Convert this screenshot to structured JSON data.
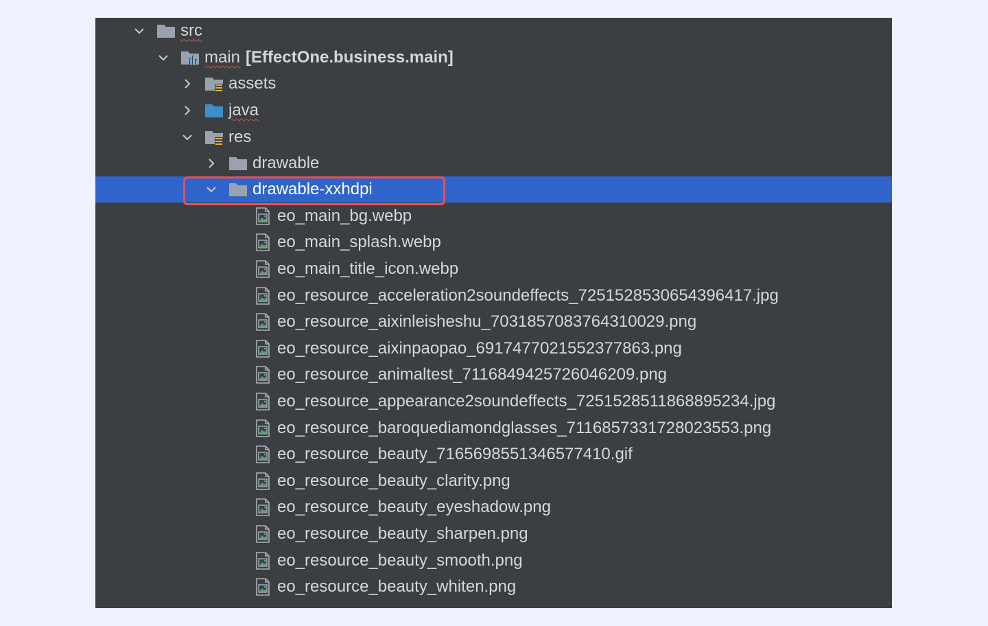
{
  "tree": {
    "src": {
      "label": "src",
      "expanded": true,
      "icon": "folder-icon"
    },
    "main": {
      "label": "main",
      "module": "[EffectOne.business.main]",
      "expanded": true,
      "icon": "module-folder-icon"
    },
    "assets": {
      "label": "assets",
      "expanded": false,
      "icon": "resource-folder-icon"
    },
    "java": {
      "label": "java",
      "expanded": false,
      "icon": "source-folder-icon"
    },
    "res": {
      "label": "res",
      "expanded": true,
      "icon": "resource-folder-icon"
    },
    "drawable": {
      "label": "drawable",
      "expanded": false,
      "icon": "folder-icon"
    },
    "drawable_xxhdpi": {
      "label": "drawable-xxhdpi",
      "expanded": true,
      "selected": true,
      "icon": "folder-icon"
    },
    "files": [
      "eo_main_bg.webp",
      "eo_main_splash.webp",
      "eo_main_title_icon.webp",
      "eo_resource_acceleration2soundeffects_7251528530654396417.jpg",
      "eo_resource_aixinleisheshu_7031857083764310029.png",
      "eo_resource_aixinpaopao_6917477021552377863.png",
      "eo_resource_animaltest_7116849425726046209.png",
      "eo_resource_appearance2soundeffects_7251528511868895234.jpg",
      "eo_resource_baroquediamondglasses_7116857331728023553.png",
      "eo_resource_beauty_7165698551346577410.gif",
      "eo_resource_beauty_clarity.png",
      "eo_resource_beauty_eyeshadow.png",
      "eo_resource_beauty_sharpen.png",
      "eo_resource_beauty_smooth.png",
      "eo_resource_beauty_whiten.png"
    ]
  },
  "colors": {
    "panel_bg": "#3c3f41",
    "selection": "#2f65ca",
    "highlight_outline": "#ec4f55",
    "text": "#d5d7d9"
  }
}
